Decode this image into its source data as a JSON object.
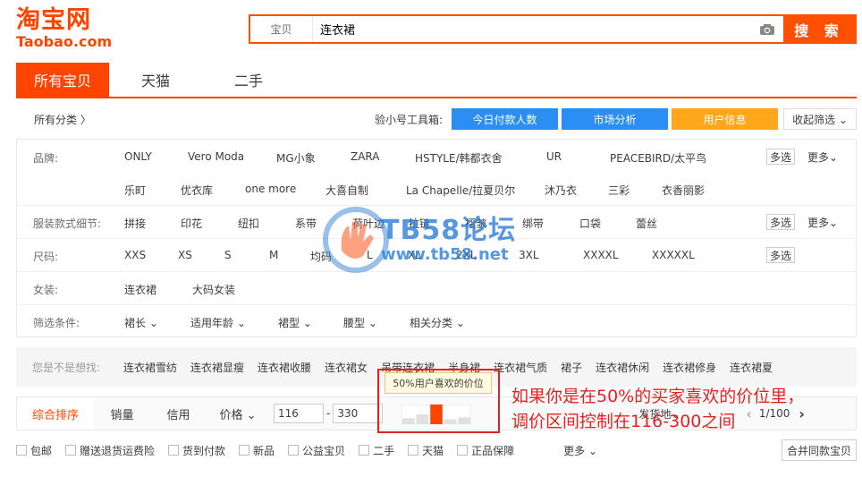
{
  "logo": {
    "cn": "淘宝网",
    "en": "Taobao.com"
  },
  "search": {
    "category": "宝贝",
    "query": "连衣裙",
    "button": "搜 索"
  },
  "tabs": [
    {
      "label": "所有宝贝"
    },
    {
      "label": "天猫"
    },
    {
      "label": "二手"
    }
  ],
  "toolbar": {
    "all_categories": "所有分类 〉",
    "tool_label": "验小号工具箱:",
    "buttons": [
      "今日付款人数",
      "市场分析",
      "用户信息"
    ],
    "collapse": "收起筛选 ⌄"
  },
  "filters": {
    "brand": {
      "label": "品牌:",
      "row1": [
        "ONLY",
        "Vero Moda",
        "MG小象",
        "ZARA",
        "HSTYLE/韩都衣舍",
        "UR",
        "PEACEBIRD/太平鸟"
      ],
      "row2": [
        "乐町",
        "优衣库",
        "one more",
        "大喜自制",
        "La Chapelle/拉夏贝尔",
        "沐乃衣",
        "三彩",
        "衣香丽影"
      ],
      "multi": "多选",
      "more": "更多⌄"
    },
    "style": {
      "label": "服装款式细节:",
      "items": [
        "拼接",
        "印花",
        "纽扣",
        "系带",
        "荷叶边",
        "拉链",
        "褶皱",
        "绑带",
        "口袋",
        "蕾丝"
      ],
      "multi": "多选",
      "more": "更多⌄"
    },
    "size": {
      "label": "尺码:",
      "items": [
        "XXS",
        "XS",
        "S",
        "M",
        "均码",
        "L",
        "XL",
        "2XL",
        "3XL",
        "XXXXL",
        "XXXXXL"
      ],
      "multi": "多选"
    },
    "women": {
      "label": "女装:",
      "items": [
        "连衣裙",
        "大码女装"
      ]
    },
    "conditions": {
      "label": "筛选条件:",
      "items": [
        "裙长 ⌄",
        "适用年龄 ⌄",
        "裙型 ⌄",
        "腰型 ⌄",
        "相关分类 ⌄"
      ]
    }
  },
  "suggestions": {
    "label": "您是不是想找:",
    "items": [
      "连衣裙雪纺",
      "连衣裙显瘦",
      "连衣裙收腰",
      "连衣裙女",
      "吊带连衣裙",
      "半身裙",
      "连衣裙气质",
      "裙子",
      "连衣裙休闲",
      "连衣裙修身",
      "连衣裙夏"
    ]
  },
  "sort": {
    "items": [
      "综合排序",
      "销量",
      "信用",
      "价格 ⌄"
    ],
    "price_min": "116",
    "price_sep": "-",
    "price_max": "330",
    "ship_from": "发货地⌄",
    "page": "1/100",
    "prev": "‹",
    "next": "›"
  },
  "tooltip": "50%用户喜欢的价位",
  "checks": {
    "items": [
      "包邮",
      "赠送退货运费险",
      "货到付款",
      "新品",
      "公益宝贝",
      "二手",
      "天猫",
      "正品保障"
    ],
    "more": "更多 ⌄",
    "merge": "合并同款宝贝"
  },
  "annotation": {
    "line1": "如果你是在50%的买家喜欢的价位里，",
    "line2": "调价区间控制在116-300之间"
  },
  "watermark": {
    "title": "TB58论坛",
    "url": "www.tb58.net"
  },
  "price_distribution": [
    0.3,
    0.5,
    1.0,
    0.25,
    0.35
  ],
  "colors": {
    "brand": "#ff4400",
    "blue": "#2b8ef5",
    "orange": "#ffa61a",
    "annotation": "#e52222"
  }
}
